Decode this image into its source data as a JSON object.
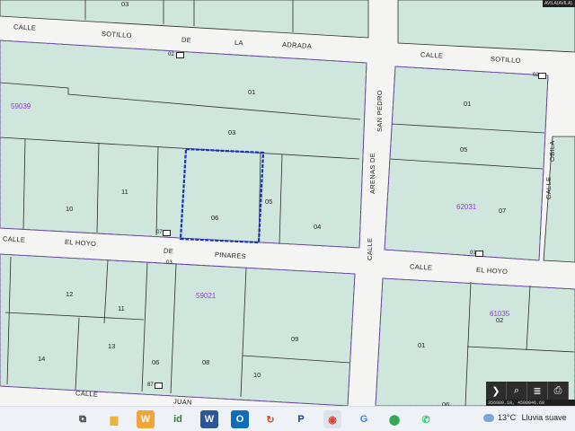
{
  "map": {
    "street_labels": {
      "calle_top_left": "CALLE",
      "sotillo_top": "SOTILLO",
      "de_top": "DE",
      "la_top": "LA",
      "adrada_top": "ADRADA",
      "calle_top_right": "CALLE",
      "sotillo_top_right": "SOTILLO",
      "calle_mid_left": "CALLE",
      "el_hoyo_left": "EL HOYO",
      "de_mid": "DE",
      "pinares": "PINARES",
      "calle_mid_right": "CALLE",
      "el_hoyo_right": "EL HOYO",
      "calle_bottom": "CALLE",
      "juan": "JUAN",
      "arenas_de": "ARENAS DE",
      "san_pedro": "SAN PEDRO",
      "calle_vertical": "CALLE",
      "calle_right_vertical": "CALLE",
      "obila": "OBILA"
    },
    "block_ids": [
      "59039",
      "62031",
      "59021",
      "61035"
    ],
    "parcel_numbers": [
      "03",
      "01",
      "03",
      "11",
      "10",
      "06",
      "05",
      "04",
      "01",
      "05",
      "07",
      "12",
      "11",
      "13",
      "14",
      "06",
      "08",
      "09",
      "10",
      "01",
      "02",
      "06"
    ],
    "portal_tags": [
      "02",
      "07",
      "03",
      "87",
      "02",
      "01"
    ],
    "selected_parcel": "06"
  },
  "map_controls": {
    "buttons": [
      {
        "name": "next-arrow-icon",
        "glyph": "❯"
      },
      {
        "name": "search-icon",
        "glyph": "⌕"
      },
      {
        "name": "layers-icon",
        "glyph": "≣"
      },
      {
        "name": "print-icon",
        "glyph": "⎙"
      }
    ],
    "coordinates": "356980.10, 4500046.68",
    "corner_text": "AVILA(AVILA)"
  },
  "taskbar": {
    "icons": [
      {
        "name": "task-view-icon",
        "glyph": "⧉",
        "color": "#333333"
      },
      {
        "name": "file-explorer-icon",
        "glyph": "▆",
        "color": "#e8b43a"
      },
      {
        "name": "wps-office-icon",
        "glyph": "W",
        "color": "#e85b2d"
      },
      {
        "name": "id-app-icon",
        "glyph": "id",
        "color": "#2a7d3a"
      },
      {
        "name": "word-icon",
        "glyph": "W",
        "color": "#2b5797"
      },
      {
        "name": "outlook-icon",
        "glyph": "O",
        "color": "#0f6cbd"
      },
      {
        "name": "refresh-app-icon",
        "glyph": "↻",
        "color": "#d9442b"
      },
      {
        "name": "p-app-icon",
        "glyph": "P",
        "color": "#1d3f8f"
      },
      {
        "name": "chrome-icon",
        "glyph": "◉",
        "color": "#db4437"
      },
      {
        "name": "google-icon",
        "glyph": "G",
        "color": "#4285f4"
      },
      {
        "name": "maps-icon",
        "glyph": "⬤",
        "color": "#34a853"
      },
      {
        "name": "whatsapp-icon",
        "glyph": "✆",
        "color": "#25d366"
      }
    ],
    "weather": {
      "temperature": "13°C",
      "description": "Lluvia suave"
    }
  }
}
